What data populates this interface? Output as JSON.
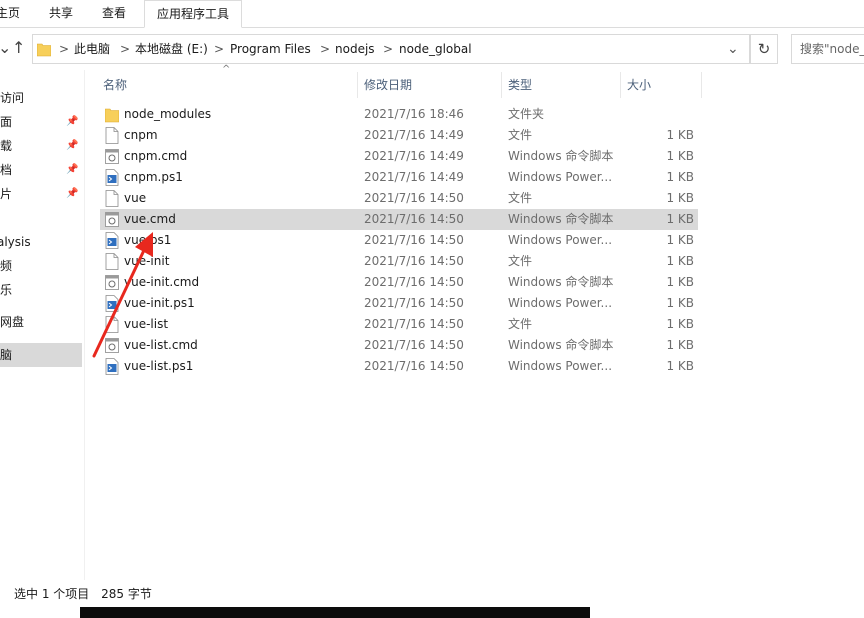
{
  "ribbon": {
    "tabs": [
      {
        "label": "主页"
      },
      {
        "label": "共享"
      },
      {
        "label": "查看"
      },
      {
        "label": "应用程序工具"
      }
    ]
  },
  "address": {
    "crumbs": [
      "此电脑",
      "本地磁盘 (E:)",
      "Program Files",
      "nodejs",
      "node_global"
    ],
    "separator": ">",
    "search_placeholder": "搜索\"node_global\""
  },
  "nav": {
    "items": [
      {
        "label": "快速访问"
      },
      {
        "label": "桌面"
      },
      {
        "label": "下载"
      },
      {
        "label": "文档"
      },
      {
        "label": "图片"
      },
      {
        "label": "analysis"
      },
      {
        "label": "视频"
      },
      {
        "label": "音乐"
      },
      {
        "label": "百度网盘"
      },
      {
        "label": "此电脑"
      }
    ]
  },
  "columns": {
    "name": "名称",
    "date": "修改日期",
    "type": "类型",
    "size": "大小"
  },
  "files": [
    {
      "name": "node_modules",
      "date": "2021/7/16 18:46",
      "type": "文件夹",
      "size": "",
      "icon": "folder-icon"
    },
    {
      "name": "cnpm",
      "date": "2021/7/16 14:49",
      "type": "文件",
      "size": "1 KB",
      "icon": "file-icon"
    },
    {
      "name": "cnpm.cmd",
      "date": "2021/7/16 14:49",
      "type": "Windows 命令脚本",
      "size": "1 KB",
      "icon": "cmd-file-icon"
    },
    {
      "name": "cnpm.ps1",
      "date": "2021/7/16 14:49",
      "type": "Windows Power...",
      "size": "1 KB",
      "icon": "powershell-file-icon"
    },
    {
      "name": "vue",
      "date": "2021/7/16 14:50",
      "type": "文件",
      "size": "1 KB",
      "icon": "file-icon"
    },
    {
      "name": "vue.cmd",
      "date": "2021/7/16 14:50",
      "type": "Windows 命令脚本",
      "size": "1 KB",
      "icon": "cmd-file-icon",
      "selected": true
    },
    {
      "name": "vue.ps1",
      "date": "2021/7/16 14:50",
      "type": "Windows Power...",
      "size": "1 KB",
      "icon": "powershell-file-icon"
    },
    {
      "name": "vue-init",
      "date": "2021/7/16 14:50",
      "type": "文件",
      "size": "1 KB",
      "icon": "file-icon"
    },
    {
      "name": "vue-init.cmd",
      "date": "2021/7/16 14:50",
      "type": "Windows 命令脚本",
      "size": "1 KB",
      "icon": "cmd-file-icon"
    },
    {
      "name": "vue-init.ps1",
      "date": "2021/7/16 14:50",
      "type": "Windows Power...",
      "size": "1 KB",
      "icon": "powershell-file-icon"
    },
    {
      "name": "vue-list",
      "date": "2021/7/16 14:50",
      "type": "文件",
      "size": "1 KB",
      "icon": "file-icon"
    },
    {
      "name": "vue-list.cmd",
      "date": "2021/7/16 14:50",
      "type": "Windows 命令脚本",
      "size": "1 KB",
      "icon": "cmd-file-icon"
    },
    {
      "name": "vue-list.ps1",
      "date": "2021/7/16 14:50",
      "type": "Windows Power...",
      "size": "1 KB",
      "icon": "powershell-file-icon"
    }
  ],
  "status": {
    "selected": "选中 1 个项目",
    "size": "285 字节"
  },
  "colors": {
    "selection": "#d9d9d9",
    "annotation_arrow": "#e8281e",
    "header_text": "#4c607a"
  }
}
